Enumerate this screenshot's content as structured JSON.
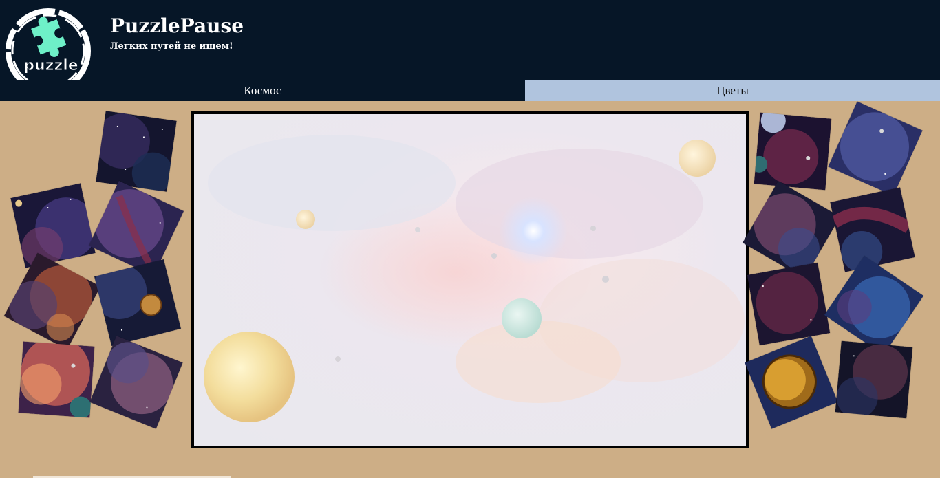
{
  "header": {
    "title": "PuzzlePause",
    "tagline": "Легких путей не ищем!",
    "logo_text": "puzzle",
    "logo_icon": "puzzle-piece-icon"
  },
  "tabs": [
    {
      "label": "Космос",
      "active": true
    },
    {
      "label": "Цветы",
      "active": false
    }
  ],
  "board": {
    "theme": "space",
    "image": "space-nebula-preview"
  },
  "pieces": {
    "left_count": 8,
    "right_count": 8
  },
  "colors": {
    "header_bg": "#061627",
    "page_bg": "#cdae86",
    "tab_inactive_bg": "#b0c4de",
    "logo_accent": "#6ef0c8",
    "board_border": "#000000"
  }
}
